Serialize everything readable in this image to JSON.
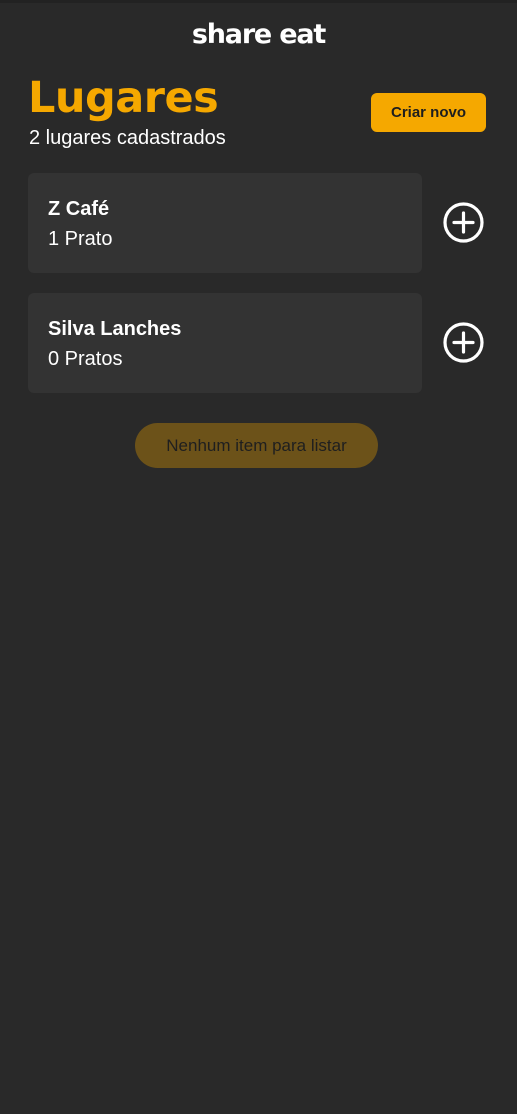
{
  "app": {
    "logo": "share eat"
  },
  "header": {
    "title": "Lugares",
    "subtitle": "2 lugares cadastrados",
    "create_label": "Criar novo"
  },
  "places": [
    {
      "name": "Z Café",
      "count": "1 Prato",
      "add_icon": "plus-circle-icon"
    },
    {
      "name": "Silva Lanches",
      "count": "0 Pratos",
      "add_icon": "plus-circle-icon"
    }
  ],
  "empty_state": {
    "message": "Nenhum item para listar"
  },
  "colors": {
    "background": "#292929",
    "card": "#333333",
    "accent": "#f5a800",
    "empty_pill": "#6c5219"
  }
}
